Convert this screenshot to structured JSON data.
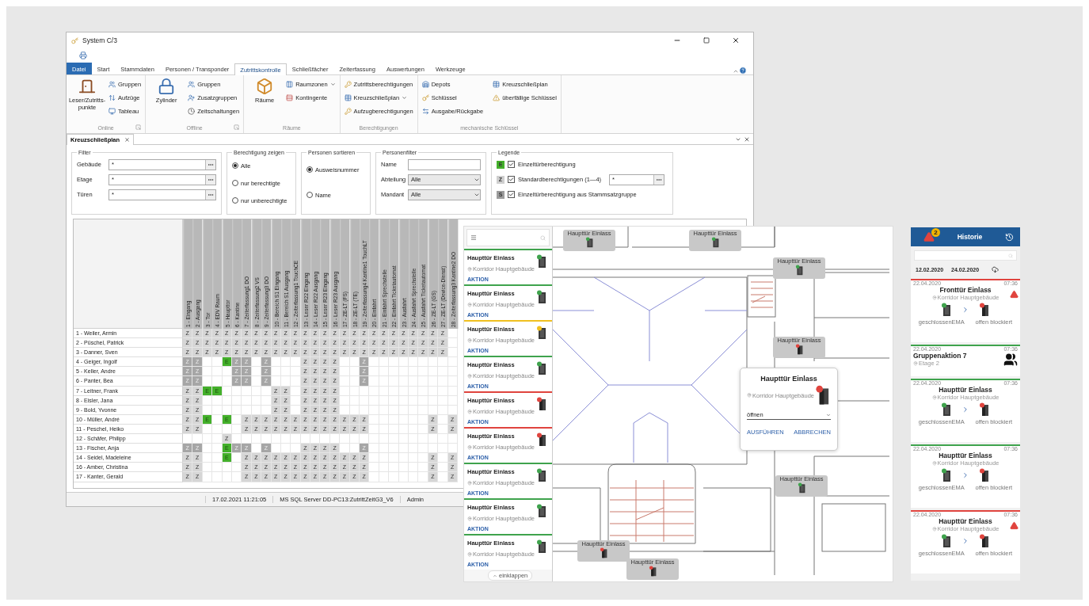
{
  "desktop_window": {
    "title": "System C/3",
    "ribbon": {
      "tabs": [
        {
          "label": "Datei",
          "kind": "file",
          "selected": false
        },
        {
          "label": "Start",
          "kind": "tab",
          "selected": false
        },
        {
          "label": "Stammdaten",
          "kind": "tab",
          "selected": false
        },
        {
          "label": "Personen / Transponder",
          "kind": "tab",
          "selected": false
        },
        {
          "label": "Zutrittskontrolle",
          "kind": "tab",
          "selected": true
        },
        {
          "label": "Schließfächer",
          "kind": "tab",
          "selected": false
        },
        {
          "label": "Zeiterfassung",
          "kind": "tab",
          "selected": false
        },
        {
          "label": "Auswertungen",
          "kind": "tab",
          "selected": false
        },
        {
          "label": "Werkzeuge",
          "kind": "tab",
          "selected": false
        }
      ],
      "groups": [
        {
          "label": "Online",
          "launcher": true,
          "large": [
            {
              "label": "Leser/Zutritts-punkte"
            }
          ],
          "small": [
            {
              "label": "Gruppen",
              "dropdown": false
            },
            {
              "label": "Aufzüge",
              "dropdown": false
            },
            {
              "label": "Tableau",
              "dropdown": false
            }
          ]
        },
        {
          "label": "Offline",
          "launcher": true,
          "large": [
            {
              "label": "Zylinder"
            }
          ],
          "small": [
            {
              "label": "Gruppen",
              "dropdown": false
            },
            {
              "label": "Zusatzgruppen",
              "dropdown": false
            },
            {
              "label": "Zeitschaltungen",
              "dropdown": false
            }
          ]
        },
        {
          "label": "Räume",
          "launcher": false,
          "large": [
            {
              "label": "Räume"
            }
          ],
          "small": [
            {
              "label": "Raumzonen",
              "dropdown": true
            },
            {
              "label": "Kontingente",
              "dropdown": false
            }
          ]
        },
        {
          "label": "Berechtigungen",
          "launcher": false,
          "small": [
            {
              "label": "Zutrittsberechtigungen",
              "dropdown": false
            },
            {
              "label": "Kreuzschließplan",
              "dropdown": true
            },
            {
              "label": "Aufzugberechtigungen",
              "dropdown": false
            }
          ]
        },
        {
          "label": "mechanische Schlüssel",
          "launcher": false,
          "small": [
            {
              "label": "Depots",
              "dropdown": false
            },
            {
              "label": "Schlüssel",
              "dropdown": false
            },
            {
              "label": "Ausgabe/Rückgabe",
              "dropdown": false
            },
            {
              "label": "Kreuzschließplan",
              "dropdown": false
            },
            {
              "label": "überfällige Schlüssel",
              "dropdown": false
            }
          ]
        }
      ]
    },
    "document_tab": {
      "label": "Kreuzschließplan"
    },
    "filter": {
      "title": "Filter",
      "fields": [
        {
          "label": "Gebäude",
          "value": "*"
        },
        {
          "label": "Etage",
          "value": "*"
        },
        {
          "label": "Türen",
          "value": "*"
        }
      ]
    },
    "show_permission": {
      "title": "Berechtigung zeigen",
      "options": [
        {
          "label": "Alle",
          "selected": true
        },
        {
          "label": "nur berechtigte",
          "selected": false
        },
        {
          "label": "nur unberechtigte",
          "selected": false
        }
      ]
    },
    "sort_persons": {
      "title": "Personen sortieren",
      "options": [
        {
          "label": "Ausweisnummer",
          "selected": true
        },
        {
          "label": "Name",
          "selected": false
        }
      ]
    },
    "person_filter": {
      "title": "Personenfilter",
      "fields": [
        {
          "label": "Name",
          "kind": "text"
        },
        {
          "label": "Abteilung",
          "kind": "select",
          "value": "Alle"
        },
        {
          "label": "Mandant",
          "kind": "select",
          "value": "Alle"
        }
      ]
    },
    "legend": {
      "title": "Legende",
      "items": [
        {
          "symbol": "E",
          "color": "#43b02a",
          "label": "Einzeltürberechtigung",
          "checked": true
        },
        {
          "symbol": "Z",
          "color": "#cfcfcf",
          "label": "Standardberechtigungen (1—4)",
          "checked": true,
          "field": "*"
        },
        {
          "symbol": "S",
          "color": "#9c9c9c",
          "label": "Einzeltürberechtigung aus Stammsatzgruppe",
          "checked": true
        }
      ]
    },
    "grid": {
      "columns": [
        "1 - Eingang",
        "2 - Ausgang",
        "3 - Tor",
        "4 - EDV Raum",
        "5 - Haupttor",
        "6 - Kantine",
        "7 - Zeiterfassung1 DO",
        "8 - Zeiterfassung2 VS",
        "9 - Zeiterfassung3 DO",
        "10 - Bereich S1 Eingang",
        "11 - Bereich S1 Ausgang",
        "12 - Zeiterfassung1 TouchCE",
        "13 - Leser R22 Eingang",
        "14 - Leser R22 Ausgang",
        "15 - Leser R23 Eingang",
        "16 - Leser R23 Ausgang",
        "17 - ZE-LT (FS)",
        "18 - ZE-LT (TE)",
        "19 - Zeiterfassung4 Kantine1 TouchLT",
        "20 - Einfahrt",
        "21 - Einfahrt Sprechstelle",
        "22 - Einfahrt Ticketautomat",
        "23 - Ausfahrt",
        "24 - Ausfahrt Sprechstelle",
        "25 - Ausfahrt Ticketautomat",
        "26 - ZE-LT (GS)",
        "27 - ZE-LT (Device-Dienst)",
        "28 - Zeiterfassung3 Kantine2 DO"
      ],
      "rows": [
        {
          "name": "1 - Weiler, Armin",
          "cells": [
            {
              "text": "Z",
              "kind": "standard"
            },
            {
              "text": "Z",
              "kind": "standard"
            },
            {
              "text": "Z",
              "kind": "standard"
            },
            {
              "text": "Z",
              "kind": "standard"
            },
            {
              "text": "Z",
              "kind": "standard"
            },
            {
              "text": "Z",
              "kind": "standard"
            },
            {
              "text": "Z",
              "kind": "standard"
            },
            {
              "text": "Z",
              "kind": "standard"
            },
            {
              "text": "Z",
              "kind": "standard"
            },
            {
              "text": "Z",
              "kind": "standard"
            },
            {
              "text": "Z",
              "kind": "standard"
            },
            {
              "text": "Z",
              "kind": "standard"
            },
            {
              "text": "Z",
              "kind": "standard"
            },
            {
              "text": "Z",
              "kind": "standard"
            },
            {
              "text": "Z",
              "kind": "standard"
            },
            {
              "text": "Z",
              "kind": "standard"
            },
            {
              "text": "Z",
              "kind": "standard"
            },
            {
              "text": "Z",
              "kind": "standard"
            },
            {
              "text": "Z",
              "kind": "standard"
            },
            {
              "text": "Z",
              "kind": "standard"
            },
            {
              "text": "Z",
              "kind": "standard"
            },
            {
              "text": "Z",
              "kind": "standard"
            },
            {
              "text": "Z",
              "kind": "standard"
            },
            {
              "text": "Z",
              "kind": "standard"
            },
            {
              "text": "Z",
              "kind": "standard"
            },
            {
              "text": "Z",
              "kind": "standard"
            },
            {
              "text": "Z",
              "kind": "standard"
            },
            null
          ]
        },
        {
          "name": "2 - Püschel, Patrick",
          "cells": [
            {
              "text": "Z",
              "kind": "standard"
            },
            {
              "text": "Z",
              "kind": "standard"
            },
            {
              "text": "Z",
              "kind": "standard"
            },
            {
              "text": "Z",
              "kind": "standard"
            },
            {
              "text": "Z",
              "kind": "standard"
            },
            {
              "text": "Z",
              "kind": "standard"
            },
            {
              "text": "Z",
              "kind": "standard"
            },
            {
              "text": "Z",
              "kind": "standard"
            },
            {
              "text": "Z",
              "kind": "standard"
            },
            {
              "text": "Z",
              "kind": "standard"
            },
            {
              "text": "Z",
              "kind": "standard"
            },
            {
              "text": "Z",
              "kind": "standard"
            },
            {
              "text": "Z",
              "kind": "standard"
            },
            {
              "text": "Z",
              "kind": "standard"
            },
            {
              "text": "Z",
              "kind": "standard"
            },
            {
              "text": "Z",
              "kind": "standard"
            },
            {
              "text": "Z",
              "kind": "standard"
            },
            {
              "text": "Z",
              "kind": "standard"
            },
            {
              "text": "Z",
              "kind": "standard"
            },
            {
              "text": "Z",
              "kind": "standard"
            },
            {
              "text": "Z",
              "kind": "standard"
            },
            {
              "text": "Z",
              "kind": "standard"
            },
            {
              "text": "Z",
              "kind": "standard"
            },
            {
              "text": "Z",
              "kind": "standard"
            },
            {
              "text": "Z",
              "kind": "standard"
            },
            {
              "text": "Z",
              "kind": "standard"
            },
            {
              "text": "Z",
              "kind": "standard"
            },
            null
          ]
        },
        {
          "name": "3 - Danner, Sven",
          "cells": [
            {
              "text": "Z",
              "kind": "standard"
            },
            {
              "text": "Z",
              "kind": "standard"
            },
            {
              "text": "Z",
              "kind": "standard"
            },
            {
              "text": "Z",
              "kind": "standard"
            },
            {
              "text": "Z",
              "kind": "standard"
            },
            {
              "text": "Z",
              "kind": "standard"
            },
            {
              "text": "Z",
              "kind": "standard"
            },
            {
              "text": "Z",
              "kind": "standard"
            },
            {
              "text": "Z",
              "kind": "standard"
            },
            {
              "text": "Z",
              "kind": "standard"
            },
            {
              "text": "Z",
              "kind": "standard"
            },
            {
              "text": "Z",
              "kind": "standard"
            },
            {
              "text": "Z",
              "kind": "standard"
            },
            {
              "text": "Z",
              "kind": "standard"
            },
            {
              "text": "Z",
              "kind": "standard"
            },
            {
              "text": "Z",
              "kind": "standard"
            },
            {
              "text": "Z",
              "kind": "standard"
            },
            {
              "text": "Z",
              "kind": "standard"
            },
            {
              "text": "Z",
              "kind": "standard"
            },
            {
              "text": "Z",
              "kind": "standard"
            },
            {
              "text": "Z",
              "kind": "standard"
            },
            {
              "text": "Z",
              "kind": "standard"
            },
            {
              "text": "Z",
              "kind": "standard"
            },
            {
              "text": "Z",
              "kind": "standard"
            },
            {
              "text": "Z",
              "kind": "standard"
            },
            {
              "text": "Z",
              "kind": "standard"
            },
            {
              "text": "Z",
              "kind": "standard"
            },
            null
          ]
        },
        {
          "name": "4 - Geiger, Ingolf",
          "cells": [
            {
              "text": "Z",
              "kind": "group"
            },
            {
              "text": "Z",
              "kind": "group"
            },
            null,
            null,
            {
              "text": "E",
              "kind": "single"
            },
            {
              "text": "Z",
              "kind": "group"
            },
            {
              "text": "Z",
              "kind": "group"
            },
            null,
            {
              "text": "Z",
              "kind": "group"
            },
            null,
            null,
            null,
            {
              "text": "Z",
              "kind": "standard"
            },
            {
              "text": "Z",
              "kind": "standard"
            },
            {
              "text": "Z",
              "kind": "standard"
            },
            {
              "text": "Z",
              "kind": "standard"
            },
            null,
            null,
            {
              "text": "Z",
              "kind": "group"
            },
            null,
            null,
            null,
            null,
            null,
            null,
            null,
            null,
            null
          ]
        },
        {
          "name": "5 - Keller, Andre",
          "cells": [
            {
              "text": "Z",
              "kind": "group"
            },
            {
              "text": "Z",
              "kind": "group"
            },
            null,
            null,
            null,
            {
              "text": "Z",
              "kind": "group"
            },
            {
              "text": "Z",
              "kind": "group"
            },
            null,
            {
              "text": "Z",
              "kind": "group"
            },
            null,
            null,
            null,
            {
              "text": "Z",
              "kind": "standard"
            },
            {
              "text": "Z",
              "kind": "standard"
            },
            {
              "text": "Z",
              "kind": "standard"
            },
            {
              "text": "Z",
              "kind": "standard"
            },
            null,
            null,
            {
              "text": "Z",
              "kind": "group"
            },
            null,
            null,
            null,
            null,
            null,
            null,
            null,
            null,
            null
          ]
        },
        {
          "name": "6 - Panter, Bea",
          "cells": [
            {
              "text": "Z",
              "kind": "group"
            },
            {
              "text": "Z",
              "kind": "group"
            },
            null,
            null,
            null,
            {
              "text": "Z",
              "kind": "group"
            },
            {
              "text": "Z",
              "kind": "group"
            },
            null,
            {
              "text": "Z",
              "kind": "group"
            },
            null,
            null,
            null,
            {
              "text": "Z",
              "kind": "standard"
            },
            {
              "text": "Z",
              "kind": "standard"
            },
            {
              "text": "Z",
              "kind": "standard"
            },
            {
              "text": "Z",
              "kind": "standard"
            },
            null,
            null,
            {
              "text": "Z",
              "kind": "group"
            },
            null,
            null,
            null,
            null,
            null,
            null,
            null,
            null,
            null
          ]
        },
        {
          "name": "7 - Leitner, Frank",
          "cells": [
            {
              "text": "Z",
              "kind": "standard"
            },
            {
              "text": "Z",
              "kind": "standard"
            },
            {
              "text": "E",
              "kind": "single"
            },
            {
              "text": "E",
              "kind": "single"
            },
            null,
            null,
            null,
            null,
            null,
            {
              "text": "Z",
              "kind": "standard"
            },
            {
              "text": "Z",
              "kind": "standard"
            },
            null,
            {
              "text": "Z",
              "kind": "standard"
            },
            {
              "text": "Z",
              "kind": "standard"
            },
            {
              "text": "Z",
              "kind": "standard"
            },
            {
              "text": "Z",
              "kind": "standard"
            },
            null,
            null,
            null,
            null,
            null,
            null,
            null,
            null,
            null,
            null,
            null,
            null
          ]
        },
        {
          "name": "8 - Eisler, Jana",
          "cells": [
            {
              "text": "Z",
              "kind": "standard"
            },
            {
              "text": "Z",
              "kind": "standard"
            },
            null,
            null,
            null,
            null,
            null,
            null,
            null,
            {
              "text": "Z",
              "kind": "standard"
            },
            {
              "text": "Z",
              "kind": "standard"
            },
            null,
            {
              "text": "Z",
              "kind": "standard"
            },
            {
              "text": "Z",
              "kind": "standard"
            },
            {
              "text": "Z",
              "kind": "standard"
            },
            {
              "text": "Z",
              "kind": "standard"
            },
            null,
            null,
            null,
            null,
            null,
            null,
            null,
            null,
            null,
            null,
            null,
            null
          ]
        },
        {
          "name": "9 - Bold, Yvonne",
          "cells": [
            {
              "text": "Z",
              "kind": "standard"
            },
            {
              "text": "Z",
              "kind": "standard"
            },
            null,
            null,
            null,
            null,
            null,
            null,
            null,
            {
              "text": "Z",
              "kind": "standard"
            },
            {
              "text": "Z",
              "kind": "standard"
            },
            null,
            {
              "text": "Z",
              "kind": "standard"
            },
            {
              "text": "Z",
              "kind": "standard"
            },
            {
              "text": "Z",
              "kind": "standard"
            },
            {
              "text": "Z",
              "kind": "standard"
            },
            null,
            null,
            null,
            null,
            null,
            null,
            null,
            null,
            null,
            null,
            null,
            null
          ]
        },
        {
          "name": "10 - Müller, André",
          "cells": [
            {
              "text": "Z",
              "kind": "standard"
            },
            {
              "text": "Z",
              "kind": "standard"
            },
            {
              "text": "E",
              "kind": "single"
            },
            null,
            {
              "text": "E",
              "kind": "single"
            },
            null,
            {
              "text": "Z",
              "kind": "standard"
            },
            {
              "text": "Z",
              "kind": "standard"
            },
            {
              "text": "Z",
              "kind": "standard"
            },
            {
              "text": "Z",
              "kind": "standard"
            },
            {
              "text": "Z",
              "kind": "standard"
            },
            {
              "text": "Z",
              "kind": "standard"
            },
            {
              "text": "Z",
              "kind": "standard"
            },
            {
              "text": "Z",
              "kind": "standard"
            },
            {
              "text": "Z",
              "kind": "standard"
            },
            {
              "text": "Z",
              "kind": "standard"
            },
            {
              "text": "Z",
              "kind": "standard"
            },
            {
              "text": "Z",
              "kind": "standard"
            },
            {
              "text": "Z",
              "kind": "standard"
            },
            null,
            null,
            null,
            null,
            null,
            null,
            {
              "text": "Z",
              "kind": "standard"
            },
            null,
            {
              "text": "Z",
              "kind": "standard"
            }
          ]
        },
        {
          "name": "11 - Peschel, Heiko",
          "cells": [
            {
              "text": "Z",
              "kind": "standard"
            },
            {
              "text": "Z",
              "kind": "standard"
            },
            null,
            null,
            null,
            null,
            {
              "text": "Z",
              "kind": "standard"
            },
            {
              "text": "Z",
              "kind": "standard"
            },
            {
              "text": "Z",
              "kind": "standard"
            },
            {
              "text": "Z",
              "kind": "standard"
            },
            {
              "text": "Z",
              "kind": "standard"
            },
            {
              "text": "Z",
              "kind": "standard"
            },
            {
              "text": "Z",
              "kind": "standard"
            },
            {
              "text": "Z",
              "kind": "standard"
            },
            {
              "text": "Z",
              "kind": "standard"
            },
            {
              "text": "Z",
              "kind": "standard"
            },
            {
              "text": "Z",
              "kind": "standard"
            },
            {
              "text": "Z",
              "kind": "standard"
            },
            {
              "text": "Z",
              "kind": "standard"
            },
            null,
            null,
            null,
            null,
            null,
            null,
            {
              "text": "Z",
              "kind": "standard"
            },
            null,
            {
              "text": "Z",
              "kind": "standard"
            }
          ]
        },
        {
          "name": "12 - Schäfer, Philipp",
          "cells": [
            null,
            null,
            null,
            null,
            {
              "text": "Z",
              "kind": "standard"
            },
            null,
            null,
            null,
            null,
            null,
            null,
            null,
            null,
            null,
            null,
            null,
            null,
            null,
            null,
            null,
            null,
            null,
            null,
            null,
            null,
            null,
            null,
            null
          ]
        },
        {
          "name": "13 - Fischer, Anja",
          "cells": [
            {
              "text": "Z",
              "kind": "group"
            },
            {
              "text": "Z",
              "kind": "group"
            },
            null,
            null,
            {
              "text": "E",
              "kind": "single"
            },
            {
              "text": "Z",
              "kind": "group"
            },
            {
              "text": "Z",
              "kind": "group"
            },
            null,
            {
              "text": "Z",
              "kind": "group"
            },
            null,
            null,
            null,
            {
              "text": "Z",
              "kind": "standard"
            },
            {
              "text": "Z",
              "kind": "standard"
            },
            {
              "text": "Z",
              "kind": "standard"
            },
            {
              "text": "Z",
              "kind": "standard"
            },
            null,
            null,
            {
              "text": "Z",
              "kind": "group"
            },
            null,
            null,
            null,
            null,
            null,
            null,
            null,
            null,
            null
          ]
        },
        {
          "name": "14 - Seidel, Madeleine",
          "cells": [
            {
              "text": "Z",
              "kind": "standard"
            },
            {
              "text": "Z",
              "kind": "standard"
            },
            null,
            null,
            {
              "text": "E",
              "kind": "single"
            },
            null,
            {
              "text": "Z",
              "kind": "standard"
            },
            {
              "text": "Z",
              "kind": "standard"
            },
            {
              "text": "Z",
              "kind": "standard"
            },
            {
              "text": "Z",
              "kind": "standard"
            },
            {
              "text": "Z",
              "kind": "standard"
            },
            {
              "text": "Z",
              "kind": "standard"
            },
            {
              "text": "Z",
              "kind": "standard"
            },
            {
              "text": "Z",
              "kind": "standard"
            },
            {
              "text": "Z",
              "kind": "standard"
            },
            {
              "text": "Z",
              "kind": "standard"
            },
            {
              "text": "Z",
              "kind": "standard"
            },
            {
              "text": "Z",
              "kind": "standard"
            },
            {
              "text": "Z",
              "kind": "standard"
            },
            null,
            null,
            null,
            null,
            null,
            null,
            {
              "text": "Z",
              "kind": "standard"
            },
            null,
            {
              "text": "Z",
              "kind": "standard"
            }
          ]
        },
        {
          "name": "16 - Amber, Christina",
          "cells": [
            {
              "text": "Z",
              "kind": "standard"
            },
            {
              "text": "Z",
              "kind": "standard"
            },
            null,
            null,
            null,
            null,
            {
              "text": "Z",
              "kind": "standard"
            },
            {
              "text": "Z",
              "kind": "standard"
            },
            {
              "text": "Z",
              "kind": "standard"
            },
            {
              "text": "Z",
              "kind": "standard"
            },
            {
              "text": "Z",
              "kind": "standard"
            },
            {
              "text": "Z",
              "kind": "standard"
            },
            {
              "text": "Z",
              "kind": "standard"
            },
            {
              "text": "Z",
              "kind": "standard"
            },
            {
              "text": "Z",
              "kind": "standard"
            },
            {
              "text": "Z",
              "kind": "standard"
            },
            {
              "text": "Z",
              "kind": "standard"
            },
            {
              "text": "Z",
              "kind": "standard"
            },
            {
              "text": "Z",
              "kind": "standard"
            },
            null,
            null,
            null,
            null,
            null,
            null,
            {
              "text": "Z",
              "kind": "standard"
            },
            null,
            {
              "text": "Z",
              "kind": "standard"
            }
          ]
        },
        {
          "name": "17 - Kanter, Gerald",
          "cells": [
            {
              "text": "Z",
              "kind": "standard"
            },
            {
              "text": "Z",
              "kind": "standard"
            },
            null,
            null,
            null,
            null,
            {
              "text": "Z",
              "kind": "standard"
            },
            {
              "text": "Z",
              "kind": "standard"
            },
            {
              "text": "Z",
              "kind": "standard"
            },
            {
              "text": "Z",
              "kind": "standard"
            },
            {
              "text": "Z",
              "kind": "standard"
            },
            {
              "text": "Z",
              "kind": "standard"
            },
            {
              "text": "Z",
              "kind": "standard"
            },
            {
              "text": "Z",
              "kind": "standard"
            },
            {
              "text": "Z",
              "kind": "standard"
            },
            {
              "text": "Z",
              "kind": "standard"
            },
            {
              "text": "Z",
              "kind": "standard"
            },
            {
              "text": "Z",
              "kind": "standard"
            },
            {
              "text": "Z",
              "kind": "standard"
            },
            null,
            null,
            null,
            null,
            null,
            null,
            {
              "text": "Z",
              "kind": "standard"
            },
            null,
            {
              "text": "Z",
              "kind": "standard"
            }
          ]
        }
      ]
    },
    "status_bar": [
      "17.02.2021 11:21:05",
      "MS SQL Server DD-PC13:ZutrittZeitG3_V6",
      "Admin"
    ]
  },
  "map_app": {
    "list": [
      {
        "title": "Haupttür Einlass",
        "location": "Korridor Hauptgebäude",
        "action": "AKTION",
        "kind": "ok"
      },
      {
        "title": "Haupttür Einlass",
        "location": "Korridor Hauptgebäude",
        "action": "AKTION",
        "kind": "ok"
      },
      {
        "title": "Haupttür Einlass",
        "location": "Korridor Hauptgebäude",
        "action": "AKTION",
        "kind": "warning"
      },
      {
        "title": "Haupttür Einlass",
        "location": "Korridor Hauptgebäude",
        "action": "AKTION",
        "kind": "ok"
      },
      {
        "title": "Haupttür Einlass",
        "location": "Korridor Hauptgebäude",
        "action": "AKTION",
        "kind": "alarm"
      },
      {
        "title": "Haupttür Einlass",
        "location": "Korridor Hauptgebäude",
        "action": "AKTION",
        "kind": "alarm"
      },
      {
        "title": "Haupttür Einlass",
        "location": "Korridor Hauptgebäude",
        "action": "AKTION",
        "kind": "ok"
      },
      {
        "title": "Haupttür Einlass",
        "location": "Korridor Hauptgebäude",
        "action": "AKTION",
        "kind": "ok"
      },
      {
        "title": "Haupttür Einlass",
        "location": "Korridor Hauptgebäude",
        "action": "AKTION",
        "kind": "ok"
      }
    ],
    "collapse_button": "einklappen",
    "markers": [
      {
        "label": "Haupttür Einlass",
        "kind": "ok"
      },
      {
        "label": "Haupttür Einlass",
        "kind": "ok"
      },
      {
        "label": "Haupttür Einlass",
        "kind": "ok"
      },
      {
        "label": "Haupttür Einlass",
        "kind": "alarm"
      },
      {
        "label": "Haupttür Einlass",
        "kind": "ok"
      },
      {
        "label": "Haupttür Einlass",
        "kind": "alarm"
      },
      {
        "label": "Haupttür Einlass",
        "kind": "alarm"
      }
    ],
    "popup": {
      "title": "Haupttür Einlass",
      "location": "Korridor Hauptgebäude",
      "alarm": true,
      "select": "öffnen",
      "actions": [
        "AUSFÜHREN",
        "ABBRECHEN"
      ]
    }
  },
  "mobile_app": {
    "title": "Historie",
    "alert_count": "2",
    "date_from": "12.02.2020",
    "date_to": "24.02.2020",
    "events": [
      {
        "kind": "transition",
        "color": "#e0443e",
        "alarm": true,
        "date": "22.04.2020",
        "time": "07:36",
        "title": "Fronttür Einlass",
        "location": "Korridor Hauptgebäude",
        "from": "geschlossenEMA",
        "to": "offen blockiert"
      },
      {
        "kind": "group",
        "color": "#3fa34d",
        "alarm": false,
        "date": "22.04.2020",
        "time": "07:36",
        "title": "Gruppenaktion 7",
        "location": "Etage 2"
      },
      {
        "kind": "transition",
        "color": "#3fa34d",
        "alarm": false,
        "date": "22.04.2020",
        "time": "07:36",
        "title": "Haupttür Einlass",
        "location": "Korridor Hauptgebäude",
        "from": "geschlossenEMA",
        "to": "offen blockiert"
      },
      {
        "kind": "transition",
        "color": "#3fa34d",
        "alarm": false,
        "date": "22.04.2020",
        "time": "07:36",
        "title": "Haupttür Einlass",
        "location": "Korridor Hauptgebäude",
        "from": "geschlossenEMA",
        "to": "offen blockiert"
      },
      {
        "kind": "transition",
        "color": "#e0443e",
        "alarm": true,
        "date": "22.04.2020",
        "time": "07:36",
        "title": "Haupttür Einlass",
        "location": "Korridor Hauptgebäude",
        "from": "geschlossenEMA",
        "to": "offen blockiert"
      }
    ]
  }
}
